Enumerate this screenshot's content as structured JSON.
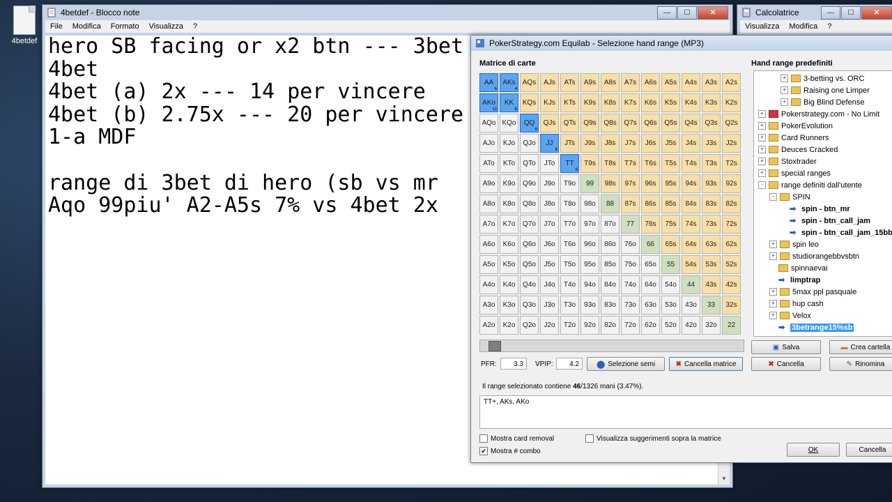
{
  "desktop": {
    "icon_label": "4betdef"
  },
  "notepad": {
    "title": "4betdef - Blocco note",
    "menu": [
      "File",
      "Modifica",
      "Formato",
      "Visualizza",
      "?"
    ],
    "lines": [
      "hero SB facing or x2 btn --- 3bet",
      "4bet",
      "4bet (a) 2x --- 14 per vincere",
      "4bet (b) 2.75x --- 20 per vincere",
      "1-a MDF",
      "",
      "range di 3bet di hero (sb vs mr",
      "Aqo 99piu' A2-A5s 7% vs 4bet 2x"
    ]
  },
  "calculator": {
    "title": "Calcolatrice",
    "menu": [
      "Visualizza",
      "Modifica",
      "?"
    ]
  },
  "equilab": {
    "title": "PokerStrategy.com Equilab - Selezione hand range (MP3)",
    "matrix_label": "Matrice di carte",
    "ranges_label": "Hand range predefiniti",
    "cells": [
      [
        "AA",
        "AKs",
        "AQs",
        "AJs",
        "ATs",
        "A9s",
        "A8s",
        "A7s",
        "A6s",
        "A5s",
        "A4s",
        "A3s",
        "A2s"
      ],
      [
        "AKo",
        "KK",
        "KQs",
        "KJs",
        "KTs",
        "K9s",
        "K8s",
        "K7s",
        "K6s",
        "K5s",
        "K4s",
        "K3s",
        "K2s"
      ],
      [
        "AQo",
        "KQo",
        "QQ",
        "QJs",
        "QTs",
        "Q9s",
        "Q8s",
        "Q7s",
        "Q6s",
        "Q5s",
        "Q4s",
        "Q3s",
        "Q2s"
      ],
      [
        "AJo",
        "KJo",
        "QJo",
        "JJ",
        "JTs",
        "J9s",
        "J8s",
        "J7s",
        "J6s",
        "J5s",
        "J4s",
        "J3s",
        "J2s"
      ],
      [
        "ATo",
        "KTo",
        "QTo",
        "JTo",
        "TT",
        "T9s",
        "T8s",
        "T7s",
        "T6s",
        "T5s",
        "T4s",
        "T3s",
        "T2s"
      ],
      [
        "A9o",
        "K9o",
        "Q9o",
        "J9o",
        "T9o",
        "99",
        "98s",
        "97s",
        "96s",
        "95s",
        "94s",
        "93s",
        "92s"
      ],
      [
        "A8o",
        "K8o",
        "Q8o",
        "J8o",
        "T8o",
        "98o",
        "88",
        "87s",
        "86s",
        "85s",
        "84s",
        "83s",
        "82s"
      ],
      [
        "A7o",
        "K7o",
        "Q7o",
        "J7o",
        "T7o",
        "97o",
        "87o",
        "77",
        "76s",
        "75s",
        "74s",
        "73s",
        "72s"
      ],
      [
        "A6o",
        "K6o",
        "Q6o",
        "J6o",
        "T6o",
        "96o",
        "86o",
        "76o",
        "66",
        "65s",
        "64s",
        "63s",
        "62s"
      ],
      [
        "A5o",
        "K5o",
        "Q5o",
        "J5o",
        "T5o",
        "95o",
        "85o",
        "75o",
        "65o",
        "55",
        "54s",
        "53s",
        "52s"
      ],
      [
        "A4o",
        "K4o",
        "Q4o",
        "J4o",
        "T4o",
        "94o",
        "84o",
        "74o",
        "64o",
        "54o",
        "44",
        "43s",
        "42s"
      ],
      [
        "A3o",
        "K3o",
        "Q3o",
        "J3o",
        "T3o",
        "93o",
        "83o",
        "73o",
        "63o",
        "53o",
        "43o",
        "33",
        "32s"
      ],
      [
        "A2o",
        "K2o",
        "Q2o",
        "J2o",
        "T2o",
        "92o",
        "82o",
        "72o",
        "62o",
        "52o",
        "42o",
        "32o",
        "22"
      ]
    ],
    "selected": {
      "AA": "6",
      "AKs": "4",
      "AKo": "12",
      "KK": "6",
      "QQ": "6",
      "JJ": "6",
      "TT": "6"
    },
    "pfr_label": "PFR:",
    "pfr": "3.3",
    "vpip_label": "VPIP:",
    "vpip": "4.2",
    "buttons": {
      "select_semi": "Selezione semi",
      "clear_matrix": "Cancella matrice",
      "save": "Salva",
      "create_folder": "Crea cartella",
      "delete": "Cancella",
      "rename": "Rinomina",
      "ok": "OK",
      "cancel": "Cancella"
    },
    "info_prefix": "Il range selezionato contiene ",
    "info_count": "46",
    "info_suffix": "/1326 mani (3.47%).",
    "range_text": "TT+, AKs, AKo",
    "checkboxes": {
      "card_removal": "Mostra card removal",
      "suggestions": "Visualizza suggerimenti sopra la matrice",
      "combo": "Mostra # combo"
    },
    "tree": [
      {
        "label": "3-betting vs. ORC",
        "type": "folder",
        "expander": "+",
        "indent": 2
      },
      {
        "label": "Raising one Limper",
        "type": "folder",
        "expander": "+",
        "indent": 2
      },
      {
        "label": "Big Blind Defense",
        "type": "folder",
        "expander": "+",
        "indent": 2
      },
      {
        "label": "Pokerstrategy.com - No Limit",
        "type": "ps",
        "expander": "+",
        "indent": 0
      },
      {
        "label": "PokerEvolution",
        "type": "folder",
        "expander": "+",
        "indent": 0
      },
      {
        "label": "Card Runners",
        "type": "folder",
        "expander": "+",
        "indent": 0
      },
      {
        "label": "Deuces Cracked",
        "type": "folder",
        "expander": "+",
        "indent": 0
      },
      {
        "label": "Stoxtrader",
        "type": "folder",
        "expander": "+",
        "indent": 0
      },
      {
        "label": "special ranges",
        "type": "folder",
        "expander": "+",
        "indent": 0
      },
      {
        "label": "range definiti dall'utente",
        "type": "folder",
        "expander": "-",
        "indent": 0
      },
      {
        "label": "SPIN",
        "type": "folder",
        "expander": "-",
        "indent": 1
      },
      {
        "label": "spin - btn_mr",
        "type": "range",
        "expander": "",
        "indent": 2,
        "bold": true
      },
      {
        "label": "spin - btn_call_jam",
        "type": "range",
        "expander": "",
        "indent": 2,
        "bold": true
      },
      {
        "label": "spin - btn_call_jam_15bb",
        "type": "range",
        "expander": "",
        "indent": 2,
        "bold": true
      },
      {
        "label": "spin leo",
        "type": "folder",
        "expander": "+",
        "indent": 1
      },
      {
        "label": "studiorangebbvsbtn",
        "type": "folder",
        "expander": "+",
        "indent": 1
      },
      {
        "label": "spinnaevai",
        "type": "folder",
        "expander": "",
        "indent": 1
      },
      {
        "label": "limptrap",
        "type": "range",
        "expander": "",
        "indent": 1,
        "bold": true
      },
      {
        "label": "5max ppl pasquale",
        "type": "folder",
        "expander": "+",
        "indent": 1
      },
      {
        "label": "hup cash",
        "type": "folder",
        "expander": "+",
        "indent": 1
      },
      {
        "label": "Velox",
        "type": "folder",
        "expander": "+",
        "indent": 1
      },
      {
        "label": "3betrange15%sb",
        "type": "range",
        "expander": "",
        "indent": 1,
        "selected": true
      }
    ]
  }
}
